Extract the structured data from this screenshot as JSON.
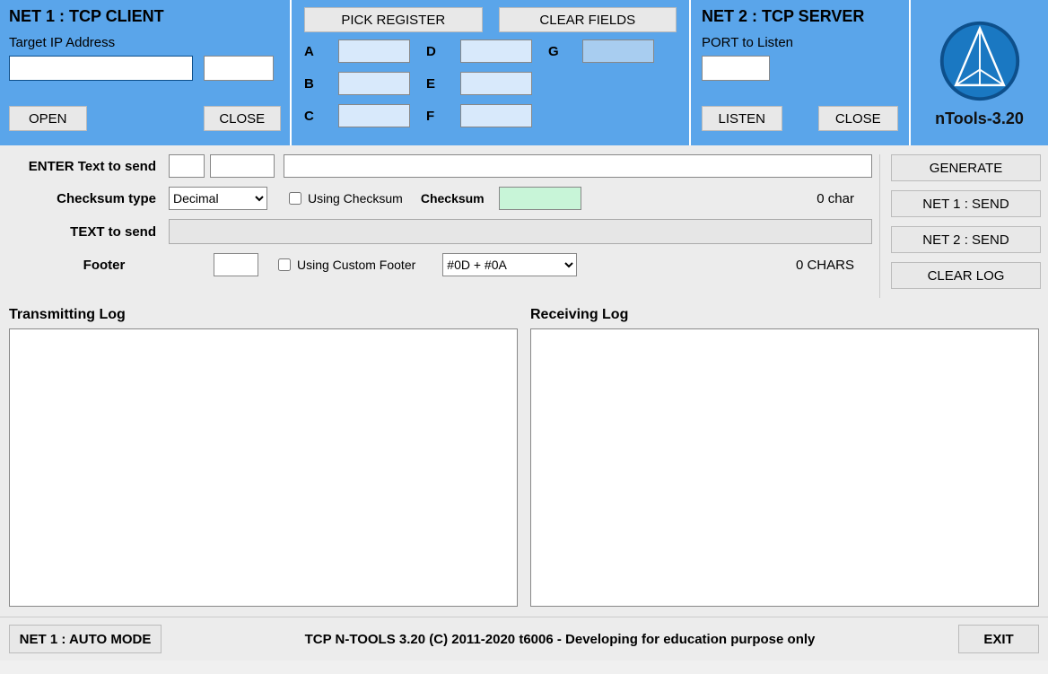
{
  "app": {
    "name": "nTools-3.20",
    "copyright": "TCP N-TOOLS 3.20 (C) 2011-2020 t6006 - Developing for education purpose only"
  },
  "net1": {
    "title": "NET 1 : TCP CLIENT",
    "ip_label": "Target IP Address",
    "ip_value": "",
    "port_value": "",
    "open": "OPEN",
    "close": "CLOSE"
  },
  "registers": {
    "pick": "PICK REGISTER",
    "clear": "CLEAR FIELDS",
    "labels": {
      "a": "A",
      "b": "B",
      "c": "C",
      "d": "D",
      "e": "E",
      "f": "F",
      "g": "G"
    },
    "values": {
      "a": "",
      "b": "",
      "c": "",
      "d": "",
      "e": "",
      "f": "",
      "g": ""
    }
  },
  "net2": {
    "title": "NET 2 : TCP SERVER",
    "port_label": "PORT to Listen",
    "port_value": "",
    "listen": "LISTEN",
    "close": "CLOSE"
  },
  "send": {
    "enter_label": "ENTER Text to send",
    "small1": "",
    "small2": "",
    "text_value": "",
    "checksum_type_label": "Checksum type",
    "checksum_type_value": "Decimal",
    "using_checksum_label": "Using Checksum",
    "checksum_label": "Checksum",
    "checksum_value": "",
    "char_count": "0 char",
    "text_to_send_label": "TEXT to send",
    "text_to_send_value": "",
    "footer_label": "Footer",
    "footer_value": "",
    "using_footer_label": "Using Custom Footer",
    "footer_select": "#0D + #0A",
    "chars_count": "0 CHARS"
  },
  "actions": {
    "generate": "GENERATE",
    "net1_send": "NET 1 : SEND",
    "net2_send": "NET 2 : SEND",
    "clear_log": "CLEAR LOG"
  },
  "logs": {
    "tx_label": "Transmitting Log",
    "rx_label": "Receiving Log",
    "tx_value": "",
    "rx_value": ""
  },
  "bottom": {
    "auto": "NET 1 : AUTO MODE",
    "exit": "EXIT"
  }
}
